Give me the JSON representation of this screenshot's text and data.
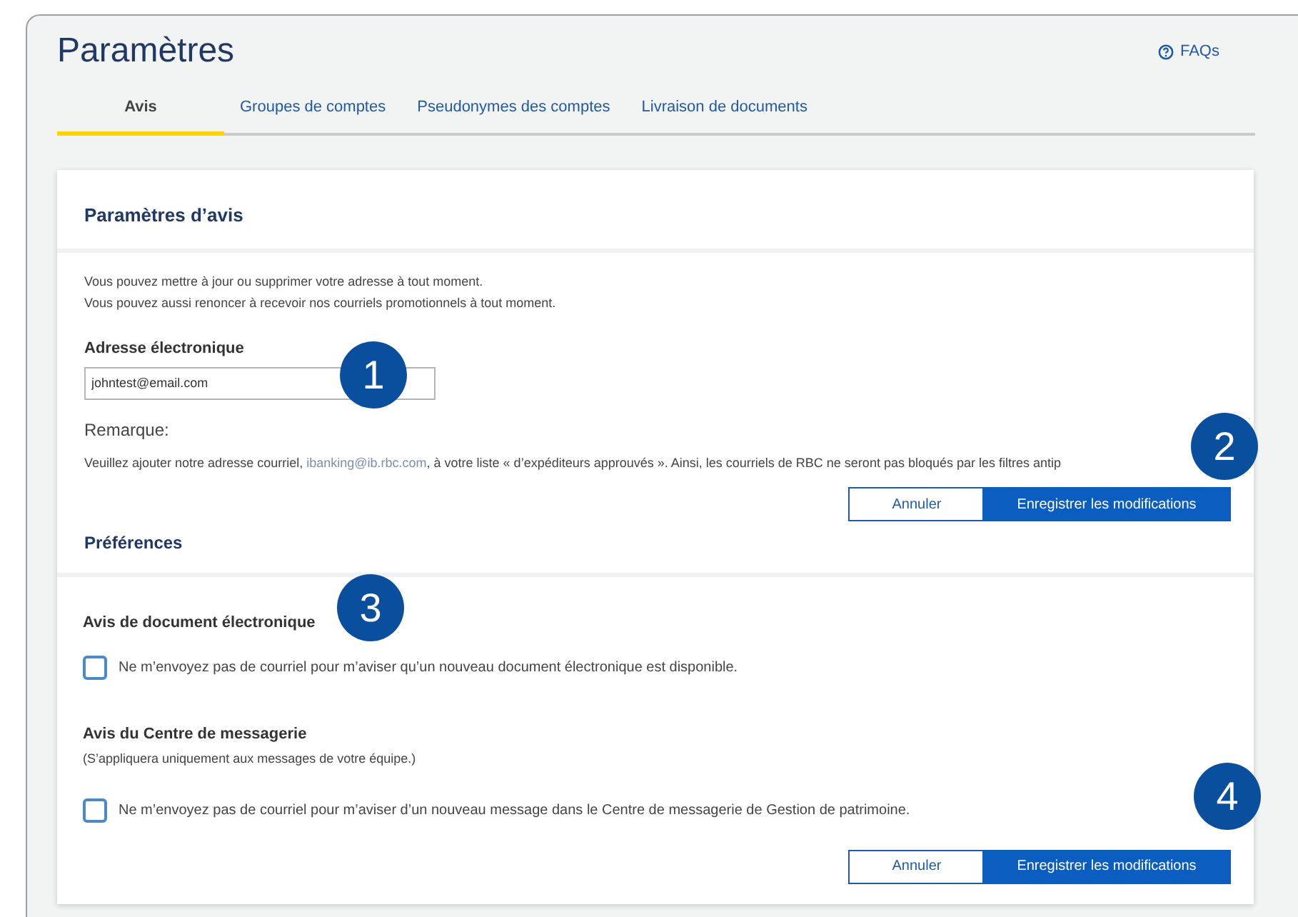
{
  "page_title": "Paramètres",
  "faq_link": "FAQs",
  "tabs": [
    {
      "label": "Avis",
      "selected": true
    },
    {
      "label": "Groupes de comptes",
      "selected": false
    },
    {
      "label": "Pseudonymes des comptes",
      "selected": false
    },
    {
      "label": "Livraison de documents",
      "selected": false
    }
  ],
  "notification_settings": {
    "title": "Paramètres d’avis",
    "intro": [
      "Vous pouvez mettre à jour ou supprimer votre adresse à tout moment.",
      "Vous pouvez aussi renoncer à recevoir nos courriels promotionnels à tout moment."
    ],
    "email_label": "Adresse électronique",
    "email_value": "johntest@email.com",
    "remark_label": "Remarque:",
    "remark_before": "Veuillez ajouter notre adresse courriel,",
    "remark_link": "ibanking@ib.rbc.com",
    "remark_after": ", à votre liste « d’expéditeurs approuvés ». Ainsi, les courriels de RBC ne seront pas bloqués par les filtres antip",
    "buttons": [
      "Annuler",
      "Enregistrer les modifications"
    ]
  },
  "preferences": {
    "title": "Préférences",
    "groups": [
      {
        "title": "Avis de document électronique",
        "option": "Ne m’envoyez pas de courriel pour m’aviser qu’un nouveau document électronique est disponible.",
        "checked": false
      },
      {
        "title": "Avis du Centre de messagerie",
        "note": "(S’appliquera uniquement aux messages de votre équipe.)",
        "option": "Ne m’envoyez pas de courriel pour m’aviser d’un nouveau message dans le Centre de messagerie de Gestion de patrimoine.",
        "checked": false
      }
    ],
    "buttons": [
      "Annuler",
      "Enregistrer les modifications"
    ]
  },
  "callouts": [
    "1",
    "2",
    "3",
    "4"
  ]
}
